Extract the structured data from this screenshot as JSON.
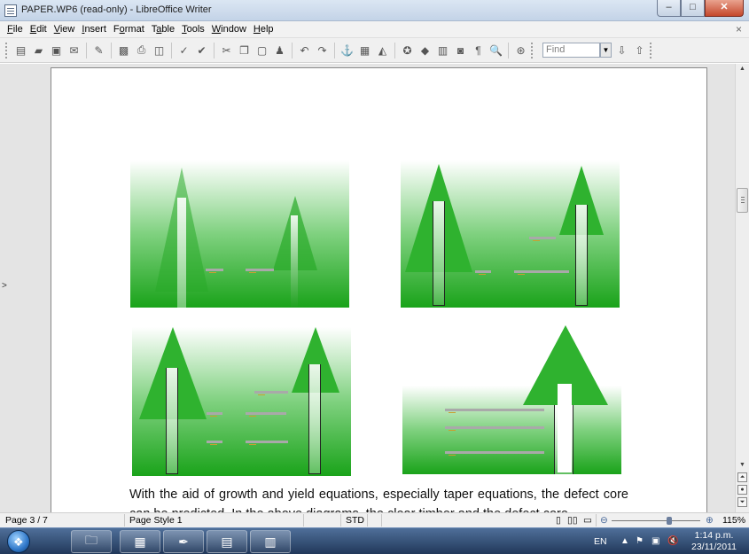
{
  "window": {
    "title": "PAPER.WP6 (read-only) - LibreOffice Writer",
    "minimize_label": "–",
    "maximize_label": "□",
    "close_label": "✕"
  },
  "menu": {
    "items": [
      {
        "mnemonic": "F",
        "rest": "ile"
      },
      {
        "mnemonic": "E",
        "rest": "dit"
      },
      {
        "mnemonic": "V",
        "rest": "iew"
      },
      {
        "mnemonic": "I",
        "rest": "nsert"
      },
      {
        "pre": "F",
        "mnemonic": "o",
        "rest": "rmat"
      },
      {
        "pre": "T",
        "mnemonic": "a",
        "rest": "ble"
      },
      {
        "mnemonic": "T",
        "rest": "ools"
      },
      {
        "mnemonic": "W",
        "rest": "indow"
      },
      {
        "mnemonic": "H",
        "rest": "elp"
      }
    ],
    "close_doc": "×"
  },
  "toolbar": {
    "find_placeholder": "Find",
    "find_dropdown": "▼",
    "find_next": "⇩",
    "find_prev": "⇧"
  },
  "document": {
    "side_marker": ">",
    "body_text": "With the aid of growth and yield equations, especially taper equations, the defect core can be predicted. In the above diagrams, the clear timber and the defect core"
  },
  "statusbar": {
    "page": "Page 3 / 7",
    "page_style": "Page Style 1",
    "mode": "STD",
    "zoom": "115%"
  },
  "taskbar": {
    "start": "❖",
    "lang": "EN",
    "time": "1:14 p.m.",
    "date": "23/11/2011"
  },
  "colors": {
    "green_dark": "#1aa31a",
    "green_light": "#7fd17f"
  }
}
